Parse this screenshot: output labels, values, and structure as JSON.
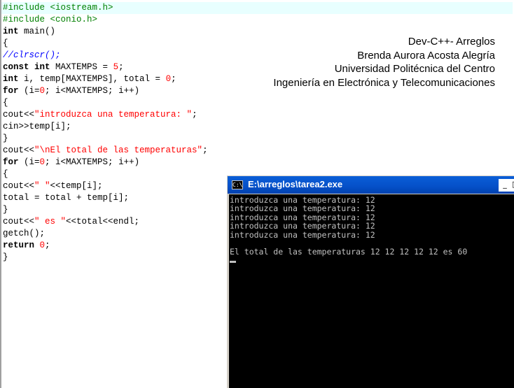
{
  "editor": {
    "lines": [
      {
        "segments": [
          {
            "t": "#include <iostream.h>",
            "c": "pp"
          }
        ]
      },
      {
        "segments": [
          {
            "t": "#include <conio.h>",
            "c": "pp"
          }
        ]
      },
      {
        "segments": [
          {
            "t": "int",
            "c": "kw"
          },
          {
            "t": " main()",
            "c": ""
          }
        ]
      },
      {
        "segments": [
          {
            "t": "{",
            "c": ""
          }
        ]
      },
      {
        "segments": [
          {
            "t": "//clrscr();",
            "c": "cmt"
          }
        ]
      },
      {
        "segments": [
          {
            "t": "const",
            "c": "kw"
          },
          {
            "t": " ",
            "c": ""
          },
          {
            "t": "int",
            "c": "kw"
          },
          {
            "t": " MAXTEMPS = ",
            "c": ""
          },
          {
            "t": "5",
            "c": "num"
          },
          {
            "t": ";",
            "c": ""
          }
        ]
      },
      {
        "segments": [
          {
            "t": "int",
            "c": "kw"
          },
          {
            "t": " i, temp[MAXTEMPS], total = ",
            "c": ""
          },
          {
            "t": "0",
            "c": "num"
          },
          {
            "t": ";",
            "c": ""
          }
        ]
      },
      {
        "segments": [
          {
            "t": "for",
            "c": "kw"
          },
          {
            "t": " (i=",
            "c": ""
          },
          {
            "t": "0",
            "c": "num"
          },
          {
            "t": "; i<MAXTEMPS; i++)",
            "c": ""
          }
        ]
      },
      {
        "segments": [
          {
            "t": "{",
            "c": ""
          }
        ]
      },
      {
        "segments": [
          {
            "t": "cout<<",
            "c": ""
          },
          {
            "t": "\"introduzca una temperatura: \"",
            "c": "str"
          },
          {
            "t": ";",
            "c": ""
          }
        ]
      },
      {
        "segments": [
          {
            "t": "cin>>temp[i];",
            "c": ""
          }
        ]
      },
      {
        "segments": [
          {
            "t": "}",
            "c": ""
          }
        ]
      },
      {
        "segments": [
          {
            "t": "cout<<",
            "c": ""
          },
          {
            "t": "\"\\nEl total de las temperaturas\"",
            "c": "str"
          },
          {
            "t": ";",
            "c": ""
          }
        ]
      },
      {
        "segments": [
          {
            "t": "for",
            "c": "kw"
          },
          {
            "t": " (i=",
            "c": ""
          },
          {
            "t": "0",
            "c": "num"
          },
          {
            "t": "; i<MAXTEMPS; i++)",
            "c": ""
          }
        ]
      },
      {
        "segments": [
          {
            "t": "{",
            "c": ""
          }
        ]
      },
      {
        "segments": [
          {
            "t": "cout<<",
            "c": ""
          },
          {
            "t": "\" \"",
            "c": "str"
          },
          {
            "t": "<<temp[i];",
            "c": ""
          }
        ]
      },
      {
        "segments": [
          {
            "t": "total = total + temp[i];",
            "c": ""
          }
        ]
      },
      {
        "segments": [
          {
            "t": "}",
            "c": ""
          }
        ]
      },
      {
        "segments": [
          {
            "t": "cout<<",
            "c": ""
          },
          {
            "t": "\" es \"",
            "c": "str"
          },
          {
            "t": "<<total<<endl;",
            "c": ""
          }
        ]
      },
      {
        "segments": [
          {
            "t": "getch();",
            "c": ""
          }
        ]
      },
      {
        "segments": [
          {
            "t": "return",
            "c": "kw"
          },
          {
            "t": " ",
            "c": ""
          },
          {
            "t": "0",
            "c": "num"
          },
          {
            "t": ";",
            "c": ""
          }
        ]
      },
      {
        "segments": [
          {
            "t": "}",
            "c": ""
          }
        ]
      }
    ]
  },
  "credits": {
    "line1": "Dev-C++- Arreglos",
    "line2": "Brenda Aurora Acosta Alegría",
    "line3": "Universidad Politécnica del Centro",
    "line4": "Ingeniería en Electrónica y Telecomunicaciones"
  },
  "console": {
    "icon_label": "C:\\",
    "title": "E:\\arreglos\\tarea2.exe",
    "minimize_label": "_",
    "maximize_label": "□",
    "output": [
      "introduzca una temperatura: 12",
      "introduzca una temperatura: 12",
      "introduzca una temperatura: 12",
      "introduzca una temperatura: 12",
      "introduzca una temperatura: 12",
      "",
      "El total de las temperaturas 12 12 12 12 12 es 60"
    ]
  },
  "colors": {
    "preprocessor": "#008000",
    "number": "#ff0000",
    "string": "#ff0000",
    "comment": "#0000ff",
    "titlebar": "#0550c8",
    "console_bg": "#000000",
    "console_text": "#c0c0c0"
  }
}
